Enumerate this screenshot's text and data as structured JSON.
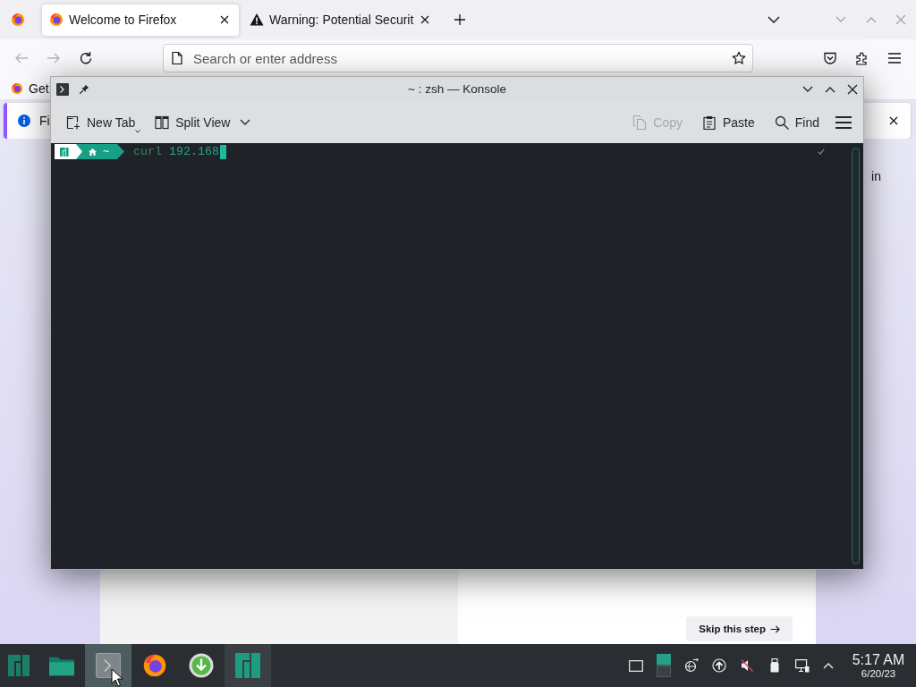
{
  "firefox": {
    "tabs": [
      {
        "title": "Welcome to Firefox",
        "selected": true,
        "warning": false
      },
      {
        "title": "Warning: Potential Securit",
        "selected": false,
        "warning": true
      }
    ],
    "address_bar": {
      "placeholder": "Search or enter address"
    },
    "bookmarks": [
      {
        "label": "Get"
      }
    ],
    "notification": {
      "text": "Fi"
    },
    "page": {
      "text": "in",
      "skip_button": "Skip this step"
    }
  },
  "konsole": {
    "title": "~ : zsh — Konsole",
    "toolbar_left": [
      {
        "label": "New Tab",
        "disabled": false
      },
      {
        "label": "Split View",
        "disabled": false
      }
    ],
    "toolbar_right": [
      {
        "label": "Copy",
        "disabled": true
      },
      {
        "label": "Paste",
        "disabled": false
      },
      {
        "label": "Find",
        "disabled": false
      }
    ],
    "terminal": {
      "directory": "~",
      "command": "curl",
      "argument": "192.168",
      "last_command_ok": true
    }
  },
  "taskbar": {
    "tasks": [
      {
        "selected": false,
        "open": false
      },
      {
        "selected": true,
        "open": true
      },
      {
        "selected": false,
        "open": false
      },
      {
        "selected": false,
        "open": false
      },
      {
        "selected": false,
        "open": true
      }
    ],
    "clock": {
      "time": "5:17 AM",
      "date": "6/20/23"
    }
  }
}
